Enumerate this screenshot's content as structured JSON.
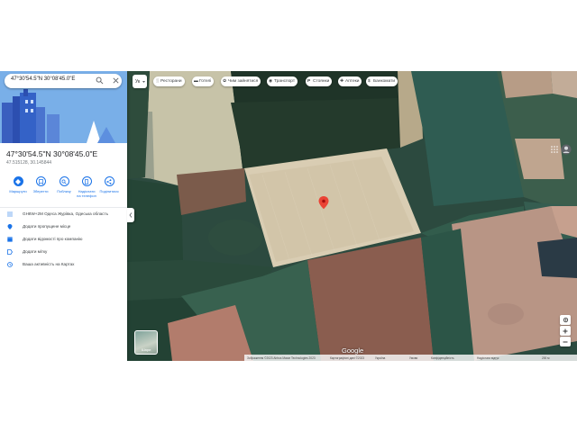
{
  "search": {
    "value": "47°30'54.5\"N 30°08'45.0\"E"
  },
  "place": {
    "title": "47°30'54.5\"N 30°08'45.0\"E",
    "subtitle": "47.515128, 30.145844"
  },
  "actions": [
    {
      "label": "Маршрути",
      "icon": "directions-icon"
    },
    {
      "label": "Зберегти",
      "icon": "bookmark-icon"
    },
    {
      "label": "Поблизу",
      "icon": "nearby-icon"
    },
    {
      "label": "Надіслати на телефон",
      "label_line1": "Надіслати",
      "label_line2": "на телефон",
      "icon": "phone-icon"
    },
    {
      "label": "Поділитися",
      "icon": "share-icon"
    }
  ],
  "info_rows": [
    {
      "text": "GH8W+2M Одеса Журівка, Одеська область",
      "icon": "plus-code-icon"
    },
    {
      "text": "Додати пропущене місце",
      "icon": "add-place-icon"
    },
    {
      "text": "Додати відомості про компанію",
      "icon": "add-business-icon"
    },
    {
      "text": "Додати мітку",
      "icon": "label-icon"
    },
    {
      "text": "Ваша активність на Картах",
      "icon": "history-icon"
    }
  ],
  "map": {
    "lang_label": "Ук",
    "chips": [
      {
        "label": "Ресторани",
        "icon": "restaurant-icon"
      },
      {
        "label": "Готелі",
        "icon": "hotel-icon"
      },
      {
        "label": "Чим зайнятися",
        "icon": "activity-icon"
      },
      {
        "label": "Транспорт",
        "icon": "transit-icon"
      },
      {
        "label": "Стоянки",
        "icon": "parking-icon"
      },
      {
        "label": "Аптеки",
        "icon": "pharmacy-icon"
      },
      {
        "label": "Банкомати",
        "icon": "atm-icon"
      }
    ],
    "layers_label": "Шари",
    "google_logo": "Google",
    "footer": {
      "attribution": "Зображення ©2023 Airbus Maxar Technologies 2023",
      "map_data": "Картографічні дані ©2023",
      "country": "Україна",
      "terms": "Умови",
      "privacy": "Конфіденційність",
      "feedback": "Надіслати відгук",
      "scale": "200 м"
    },
    "colors": {
      "marker": "#ea4335",
      "accent": "#1a73e8"
    }
  }
}
